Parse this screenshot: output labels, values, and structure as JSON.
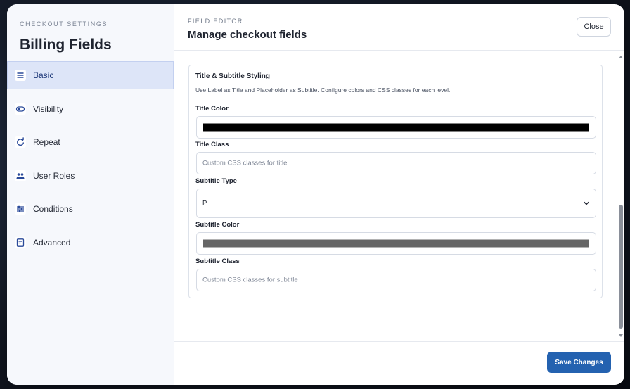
{
  "sidebar": {
    "kicker": "CHECKOUT SETTINGS",
    "title": "Billing Fields",
    "items": [
      {
        "label": "Basic",
        "icon": "menu-lines-icon"
      },
      {
        "label": "Visibility",
        "icon": "toggle-icon"
      },
      {
        "label": "Repeat",
        "icon": "repeat-icon"
      },
      {
        "label": "User Roles",
        "icon": "users-icon"
      },
      {
        "label": "Conditions",
        "icon": "sliders-icon"
      },
      {
        "label": "Advanced",
        "icon": "document-icon"
      }
    ],
    "active_item": "Basic"
  },
  "header": {
    "kicker": "FIELD EDITOR",
    "title": "Manage checkout fields",
    "close_label": "Close"
  },
  "section": {
    "title": "Title & Subtitle Styling",
    "description": "Use Label as Title and Placeholder as Subtitle. Configure colors and CSS classes for each level.",
    "title_color": {
      "label": "Title Color",
      "value": "#000000"
    },
    "title_class": {
      "label": "Title Class",
      "placeholder": "Custom CSS classes for title",
      "value": ""
    },
    "subtitle_type": {
      "label": "Subtitle Type",
      "value": "P"
    },
    "subtitle_color": {
      "label": "Subtitle Color",
      "value": "#666666"
    },
    "subtitle_class": {
      "label": "Subtitle Class",
      "placeholder": "Custom CSS classes for subtitle",
      "value": ""
    }
  },
  "footer": {
    "save_label": "Save Changes"
  },
  "colors": {
    "accent": "#2462b0",
    "active_nav_bg": "#dde5f8",
    "sidebar_bg": "#f6f8fc"
  }
}
